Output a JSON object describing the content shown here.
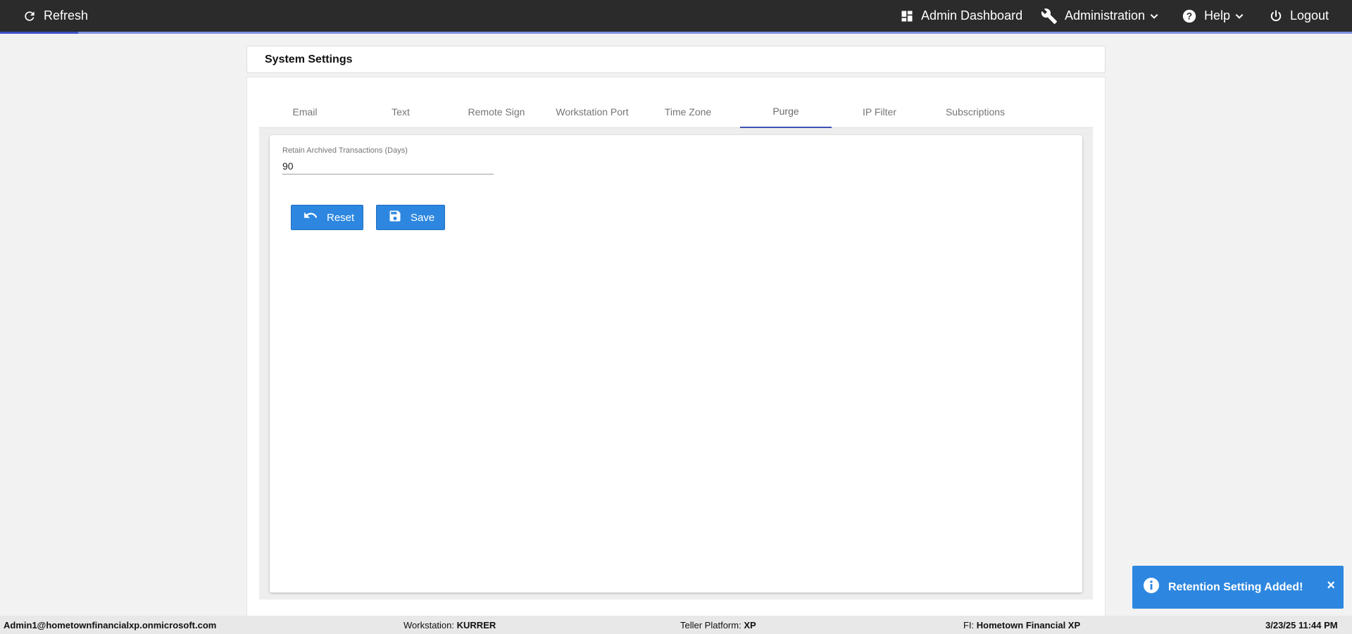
{
  "topbar": {
    "refresh_label": "Refresh",
    "admin_dashboard_label": "Admin Dashboard",
    "administration_label": "Administration",
    "help_label": "Help",
    "logout_label": "Logout"
  },
  "page": {
    "title": "System Settings"
  },
  "tabs": [
    {
      "label": "Email"
    },
    {
      "label": "Text"
    },
    {
      "label": "Remote Sign"
    },
    {
      "label": "Workstation Port"
    },
    {
      "label": "Time Zone"
    },
    {
      "label": "Purge",
      "active": true
    },
    {
      "label": "IP Filter"
    },
    {
      "label": "Subscriptions"
    }
  ],
  "purge": {
    "retain_label": "Retain Archived Transactions (Days)",
    "retain_value": "90",
    "reset_label": "Reset",
    "save_label": "Save"
  },
  "toast": {
    "message": "Retention Setting Added!",
    "close": "×"
  },
  "statusbar": {
    "user": "Admin1@hometownfinancialxp.onmicrosoft.com",
    "workstation_label": "Workstation:",
    "workstation_value": "KURRER",
    "platform_label": "Teller Platform:",
    "platform_value": "XP",
    "fi_label": "FI:",
    "fi_value": "Hometown Financial XP",
    "datetime": "3/23/25 11:44 PM"
  },
  "colors": {
    "topbar": "#2b2b2b",
    "accent": "#3f51b5",
    "button": "#2d87e0",
    "toast": "#2d87e0"
  }
}
